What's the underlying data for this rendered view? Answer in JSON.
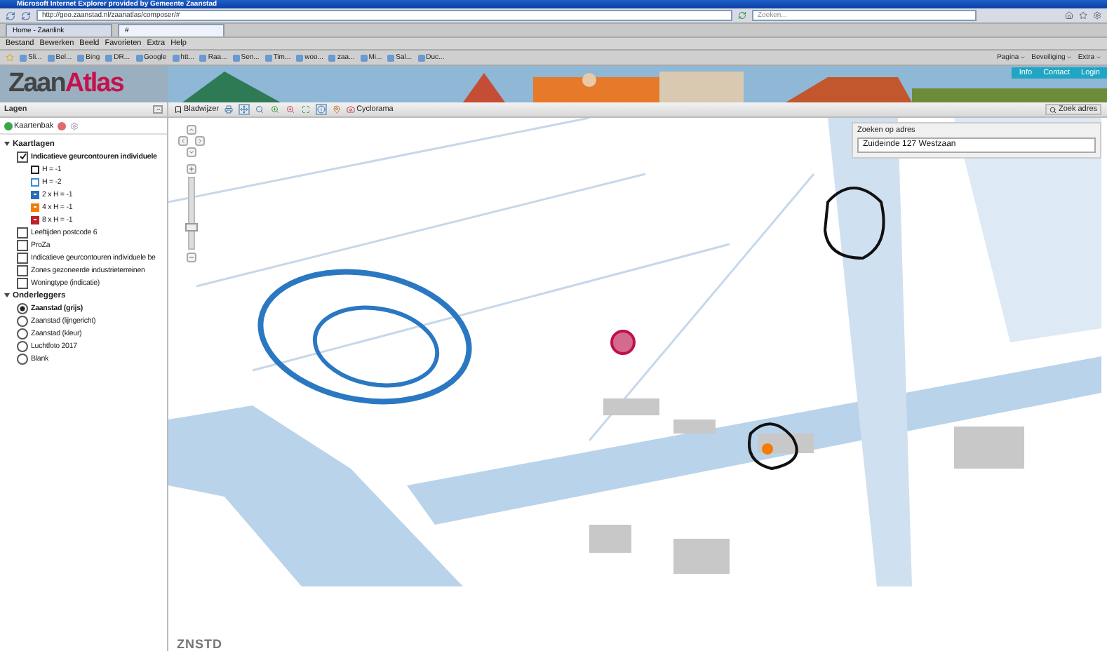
{
  "browser": {
    "title": "Microsoft Internet Explorer provided by Gemeente Zaanstad",
    "address": "http://geo.zaanstad.nl/zaanatlas/composer/#",
    "search_placeholder": "Zoeken...",
    "tabs": [
      {
        "label": "Home - Zaanlink",
        "selected": false
      },
      {
        "label": "#",
        "selected": true
      }
    ],
    "menu": [
      "Bestand",
      "Bewerken",
      "Beeld",
      "Favorieten",
      "Extra",
      "Help"
    ],
    "favorites": [
      "Sli...",
      "Bel...",
      "Bing",
      "DR...",
      "Google",
      "htt...",
      "Raa...",
      "Sen...",
      "Tim...",
      "woo...",
      "zaa...",
      "Mi...",
      "Sal...",
      "Duc..."
    ],
    "command_bar": [
      "Pagina",
      "Beveiliging",
      "Extra"
    ]
  },
  "banner": {
    "logo_part_1": "Zaan",
    "logo_part_2": "Atlas",
    "links": [
      "Info",
      "Contact",
      "Login"
    ]
  },
  "layers_panel": {
    "title": "Lagen",
    "kaartenbak": "Kaartenbak",
    "groups": [
      {
        "label": "Kaartlagen",
        "expanded": true,
        "children": [
          {
            "kind": "checkbox",
            "label": "Indicatieve geurcontouren individuele",
            "checked": true,
            "children": [
              {
                "kind": "outline",
                "label": "H = -1",
                "color": "#222222"
              },
              {
                "kind": "outline",
                "label": "H = -2",
                "color": "#3a8fd6"
              },
              {
                "kind": "filled",
                "label": "2 x H = -1",
                "color": "#2a6db5"
              },
              {
                "kind": "filled",
                "label": "4 x H = -1",
                "color": "#f57c00"
              },
              {
                "kind": "filled",
                "label": "8 x H = -1",
                "color": "#c0202a"
              }
            ]
          },
          {
            "kind": "checkbox",
            "label": "Leeftijden postcode 6",
            "checked": false
          },
          {
            "kind": "checkbox",
            "label": "ProZa",
            "checked": false
          },
          {
            "kind": "checkbox",
            "label": "Indicatieve geurcontouren individuele be",
            "checked": false
          },
          {
            "kind": "checkbox",
            "label": "Zones gezoneerde industrieterreinen",
            "checked": false
          },
          {
            "kind": "checkbox",
            "label": "Woningtype (indicatie)",
            "checked": false
          }
        ]
      },
      {
        "label": "Onderleggers",
        "expanded": true,
        "children": [
          {
            "kind": "radio",
            "label": "Zaanstad (grijs)",
            "selected": true
          },
          {
            "kind": "radio",
            "label": "Zaanstad (lijngericht)",
            "selected": false
          },
          {
            "kind": "radio",
            "label": "Zaanstad (kleur)",
            "selected": false
          },
          {
            "kind": "radio",
            "label": "Luchtfoto 2017",
            "selected": false
          },
          {
            "kind": "radio",
            "label": "Blank",
            "selected": false
          }
        ]
      }
    ]
  },
  "map": {
    "bookmark": "Bladwijzer",
    "cyclorama": "Cyclorama",
    "search_button": "Zoek adres",
    "address_search": {
      "title": "Zoeken op adres",
      "value": "Zuideinde 127 Westzaan"
    }
  },
  "footer_logo": "ZNSTD"
}
